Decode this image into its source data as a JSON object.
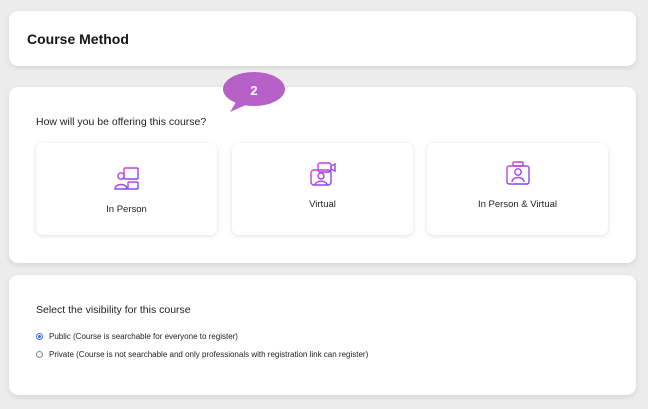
{
  "header": {
    "title": "Course Method"
  },
  "method": {
    "question": "How will you be offering this course?",
    "options": [
      {
        "label": "In Person",
        "icon": "in-person-classroom-icon"
      },
      {
        "label": "Virtual",
        "icon": "virtual-video-icon"
      },
      {
        "label": "In Person & Virtual",
        "icon": "hybrid-icon"
      }
    ]
  },
  "visibility": {
    "title": "Select the visibility for this course",
    "options": [
      {
        "label": "Public (Course is searchable for everyone to register)",
        "selected": true
      },
      {
        "label": "Private (Course is not searchable and only professionals with registration link can register)",
        "selected": false
      }
    ]
  },
  "annotation": {
    "step": "2",
    "color": "#b760c7"
  },
  "colors": {
    "icon_gradient_start": "#e03fcf",
    "icon_gradient_end": "#6b4cf0",
    "radio_accent": "#3f6fe0"
  }
}
